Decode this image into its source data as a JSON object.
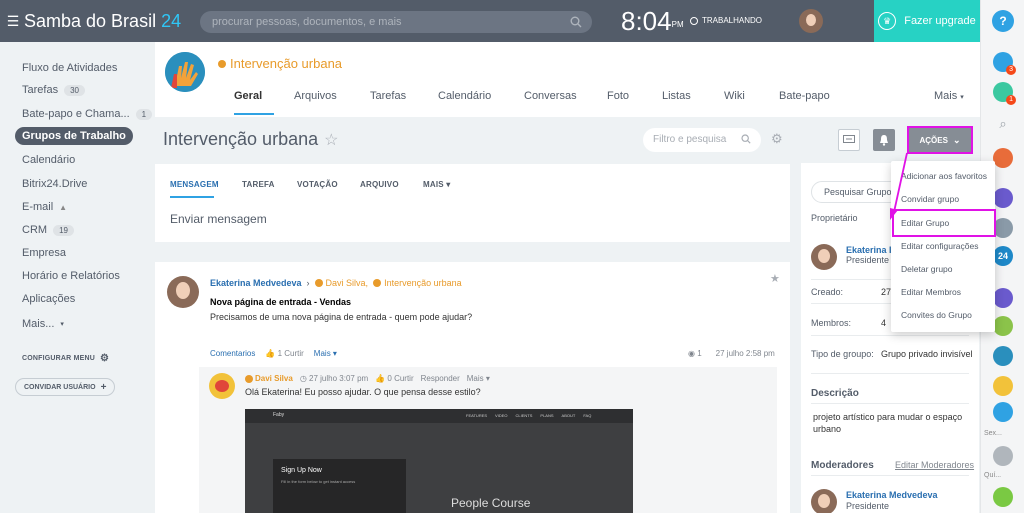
{
  "topbar": {
    "portal_name": "Samba do Brasil",
    "portal_num": "24",
    "search_placeholder": "procurar pessoas, documentos, e mais",
    "time": "8:04",
    "ampm": "PM",
    "status": "TRABALHANDO",
    "upgrade_label": "Fazer upgrade"
  },
  "sidebar": {
    "items": [
      {
        "label": "Fluxo de Atividades"
      },
      {
        "label": "Tarefas",
        "count": "30"
      },
      {
        "label": "Bate-papo e Chama...",
        "count": "1"
      },
      {
        "label": "Grupos de Trabalho"
      },
      {
        "label": "Calendário"
      },
      {
        "label": "Bitrix24.Drive"
      },
      {
        "label": "E-mail"
      },
      {
        "label": "CRM",
        "count": "19"
      },
      {
        "label": "Empresa"
      },
      {
        "label": "Horário e Relatórios"
      },
      {
        "label": "Aplicações"
      },
      {
        "label": "Mais..."
      }
    ],
    "configure": "CONFIGURAR MENU",
    "invite": "CONVIDAR USUÁRIO"
  },
  "group": {
    "name": "Intervenção urbana",
    "tabs": [
      "Geral",
      "Arquivos",
      "Tarefas",
      "Calendário",
      "Conversas",
      "Foto",
      "Listas",
      "Wiki",
      "Bate-papo",
      "Mais"
    ]
  },
  "title_row": {
    "title": "Intervenção urbana",
    "filter_placeholder": "Filtro e pesquisa",
    "actions": "AÇÕES"
  },
  "composer": {
    "tabs": [
      "MENSAGEM",
      "TAREFA",
      "VOTAÇÃO",
      "ARQUIVO",
      "MAIS"
    ],
    "placeholder": "Enviar mensagem"
  },
  "post": {
    "author": "Ekaterina Medvedeva",
    "recipients": [
      "Davi Silva,",
      "Intervenção urbana"
    ],
    "title": "Nova página de entrada - Vendas",
    "body": "Precisamos de uma nova página de entrada - quem pode ajudar?",
    "actions": {
      "comments": "Comentarios",
      "like": "1 Curtir",
      "more": "Mais"
    },
    "views": "1",
    "date": "27 julho 2:58 pm"
  },
  "comment": {
    "author": "Davi Silva",
    "date": "27 julho 3:07 pm",
    "likes": "0 Curtir",
    "reply": "Responder",
    "more": "Mais",
    "body": "Olá Ekaterina! Eu posso ajudar. O que pensa desse estilo?",
    "shot": {
      "logo": "Faby",
      "nav": [
        "FEATURES",
        "VIDEO",
        "CLIENTS",
        "PLANS",
        "ABOUT",
        "FAQ"
      ],
      "signup": "Sign Up Now",
      "fill": "Fill in the form below to get instant access",
      "bottom": "People Course"
    }
  },
  "info": {
    "search_placeholder": "Pesquisar Grupo",
    "owner_label": "Proprietário",
    "owner_name": "Ekaterina I",
    "owner_role": "Presidente",
    "created_label": "Creado:",
    "created_val": "27",
    "members_label": "Membros:",
    "members_val": "4",
    "type_label": "Tipo de groupo:",
    "type_val": "Grupo privado invisível",
    "desc_label": "Descrição",
    "desc_val": "projeto artístico para mudar o espaço urbano",
    "mods_label": "Moderadores",
    "edit_mods": "Editar Moderadores",
    "mod_name": "Ekaterina Medvedeva",
    "mod_role": "Presidente"
  },
  "dropdown": {
    "items": [
      "Adicionar aos favoritos",
      "Convidar grupo",
      "Editar Grupo",
      "Editar configurações",
      "Deletar grupo",
      "Editar Membros",
      "Convites do Grupo"
    ]
  },
  "right_rail": {
    "notif_count": "3",
    "chat_count": "1",
    "label_1": "Sex...",
    "label_2": "Quí..."
  },
  "colors": {
    "topbar": "#535c69",
    "accent": "#2fa2e3",
    "upgrade": "#27d2c4",
    "highlight": "#e012e6",
    "group_orange": "#e89b2b"
  }
}
